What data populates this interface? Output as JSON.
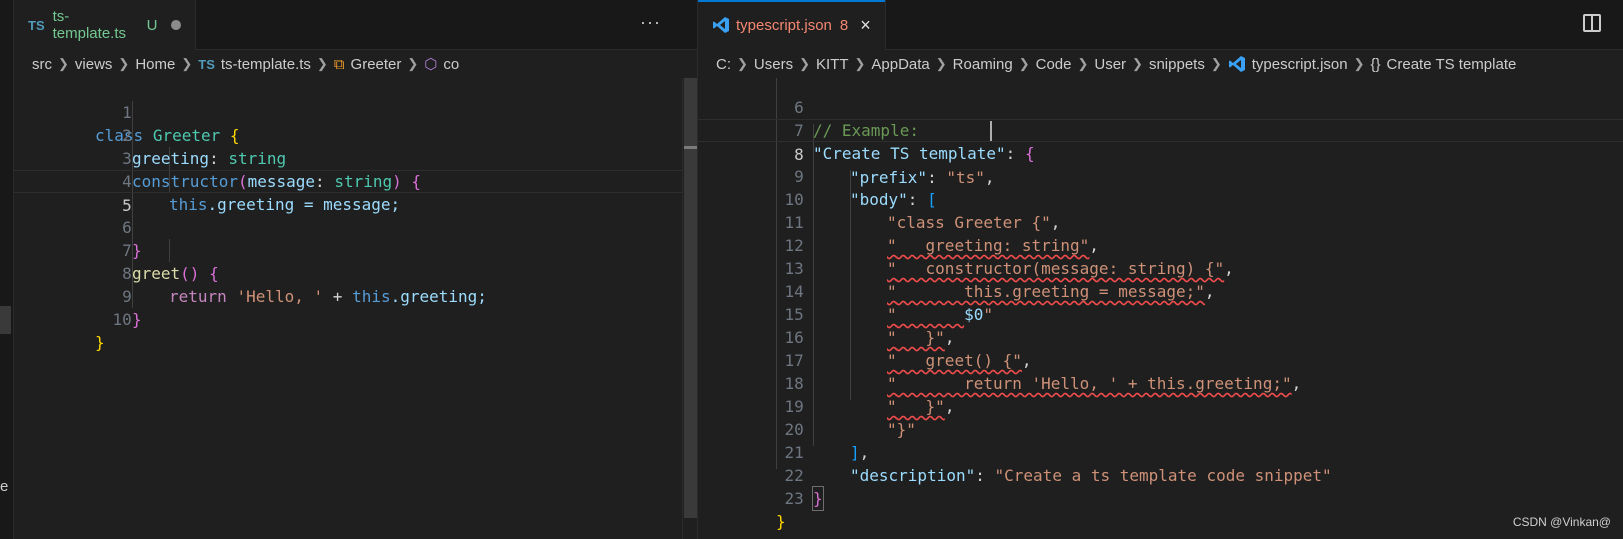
{
  "left_pane": {
    "tab": {
      "icon": "ts-file-icon",
      "icon_text": "TS",
      "name": "ts-template.ts",
      "status": "U"
    },
    "breadcrumb": {
      "items": [
        "src",
        "views",
        "Home"
      ],
      "file_icon_text": "TS",
      "file": "ts-template.ts",
      "symbol": "Greeter",
      "symbol_cut": "co"
    },
    "lines": [
      "1",
      "2",
      "3",
      "4",
      "5",
      "6",
      "7",
      "8",
      "9",
      "10"
    ],
    "active_line": "5"
  },
  "right_pane": {
    "tab": {
      "name": "typescript.json",
      "problems": "8",
      "close": "×"
    },
    "breadcrumb": {
      "items": [
        "C:",
        "Users",
        "KITT",
        "AppData",
        "Roaming",
        "Code",
        "User",
        "snippets"
      ],
      "file": "typescript.json",
      "symbol_icon_text": "{}",
      "symbol": "Create TS template"
    },
    "lines": [
      "6",
      "7",
      "8",
      "9",
      "10",
      "11",
      "12",
      "13",
      "14",
      "15",
      "16",
      "17",
      "18",
      "19",
      "20",
      "21",
      "22",
      "23"
    ],
    "active_line": "8"
  },
  "code_left": {
    "t1": "class",
    "t2": "Greeter",
    "t3": "{",
    "t4": "greeting",
    "t5": ":",
    "t6": "string",
    "t7": "constructor",
    "t8": "(",
    "t9": "message",
    "t10": ":",
    "t11": "string",
    "t12": ")",
    "t13": "{",
    "t14": "this",
    "t15": ".greeting = message;",
    "t16": "}",
    "t17": "greet",
    "t18": "()",
    "t19": "{",
    "t20": "return",
    "t21": "'Hello, '",
    "t22": "+",
    "t23": "this",
    "t24": ".greeting;",
    "t25": "}",
    "t26": "}"
  },
  "code_right": {
    "l6": "// Example:",
    "l7a": "\"Create TS template\"",
    "l7b": ":",
    "l7c": "{",
    "l8a": "\"prefix\"",
    "l8b": ":",
    "l8c": "\"ts\"",
    "l8d": ",",
    "l9a": "\"body\"",
    "l9b": ":",
    "l9c": "[",
    "l10": "\"class Greeter {\"",
    "l10b": ",",
    "l11a": "\"",
    "l11b": "   greeting: string\"",
    "l11c": ",",
    "l12a": "\"",
    "l12b": "   constructor(message: string) {\"",
    "l12c": ",",
    "l13a": "\"",
    "l13b": "       this.greeting = message;\"",
    "l13c": ",",
    "l14a": "\"",
    "l14b": "       ",
    "l14c": "$0",
    "l14d": "\"",
    "l15a": "\"",
    "l15b": "   }\"",
    "l15c": ",",
    "l16a": "\"",
    "l16b": "   greet() {\"",
    "l16c": ",",
    "l17a": "\"",
    "l17b": "       return 'Hello, ' + this.greeting;\"",
    "l17c": ",",
    "l18a": "\"",
    "l18b": "   }\"",
    "l18c": ",",
    "l19": "\"}\"",
    "l20a": "]",
    "l20b": ",",
    "l21a": "\"description\"",
    "l21b": ":",
    "l21c": "\"Create a ts template code snippet\"",
    "l22": "}",
    "l23": "}"
  },
  "watermark": "CSDN @Vinkan@",
  "left_strip_char": "e",
  "colors": {
    "accent": "#0078d4",
    "untracked": "#73c991",
    "error": "#f48771",
    "squiggle": "#f14c4c"
  }
}
